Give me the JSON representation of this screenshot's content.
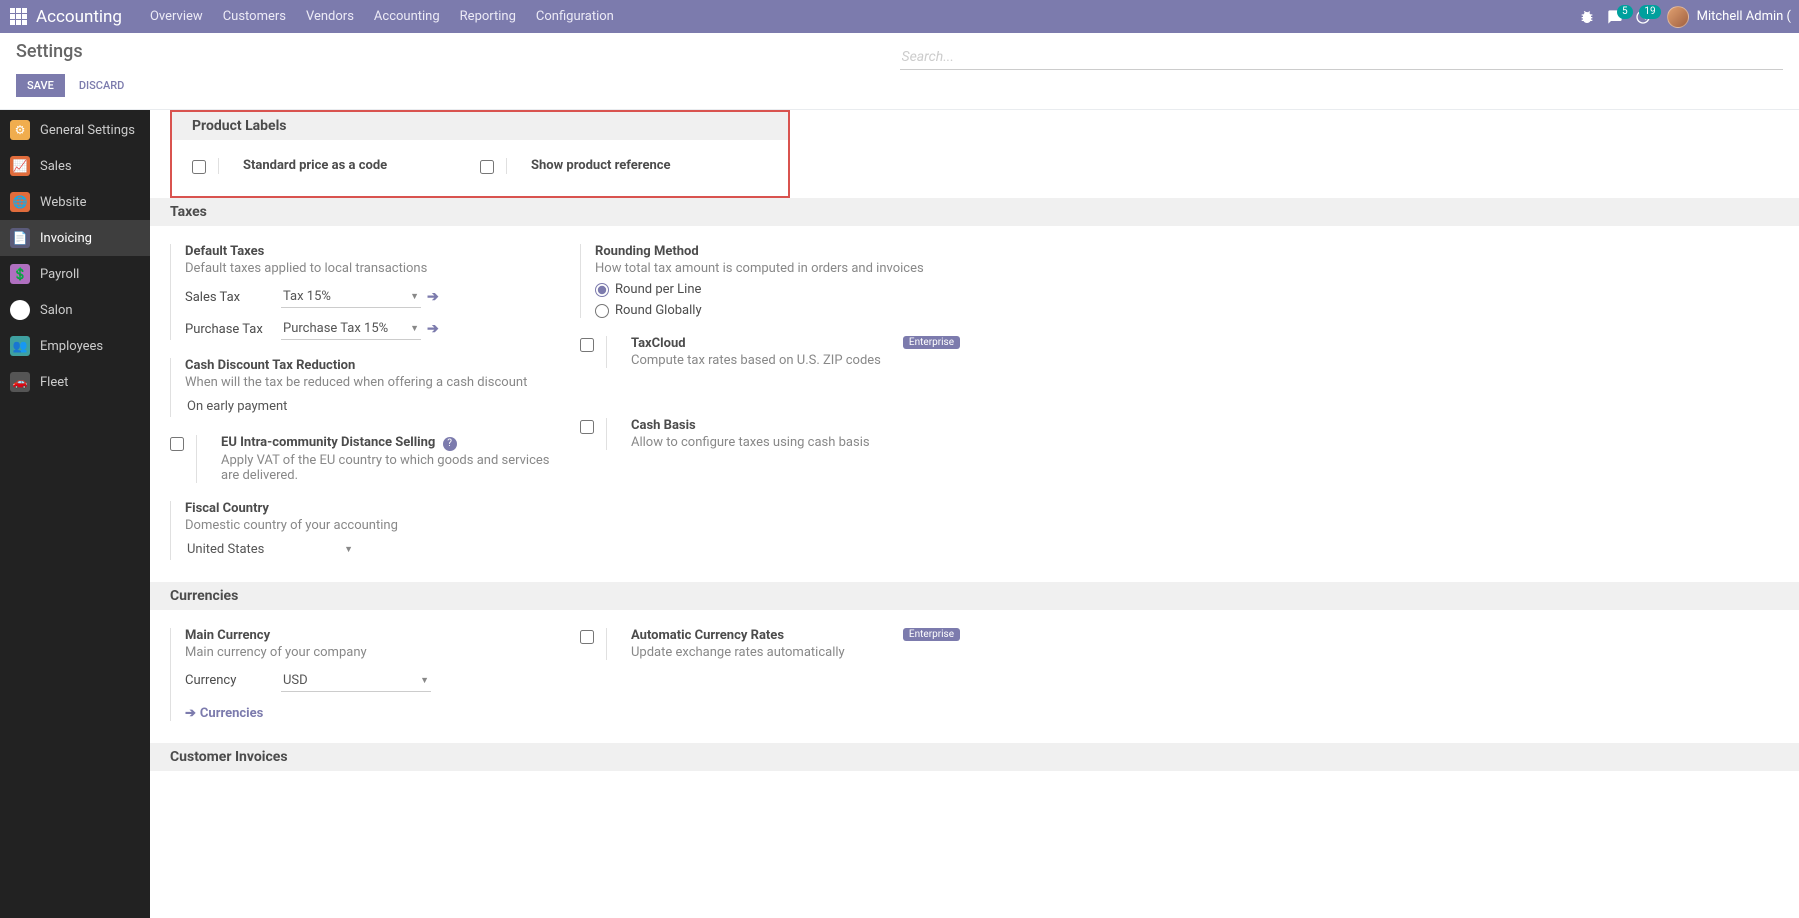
{
  "topnav": {
    "brand": "Accounting",
    "links": [
      "Overview",
      "Customers",
      "Vendors",
      "Accounting",
      "Reporting",
      "Configuration"
    ],
    "msg_badge": "5",
    "activity_badge": "19",
    "user": "Mitchell Admin ("
  },
  "control": {
    "title": "Settings",
    "save": "SAVE",
    "discard": "DISCARD",
    "search_placeholder": "Search..."
  },
  "sidebar": [
    {
      "label": "General Settings",
      "bg": "#f0ad4e"
    },
    {
      "label": "Sales",
      "bg": "#e06c3c"
    },
    {
      "label": "Website",
      "bg": "#e06c3c"
    },
    {
      "label": "Invoicing",
      "bg": "#5b5b7a",
      "active": true
    },
    {
      "label": "Payroll",
      "bg": "#b070c0"
    },
    {
      "label": "Salon",
      "bg": "#ffffff"
    },
    {
      "label": "Employees",
      "bg": "#3fa0a0"
    },
    {
      "label": "Fleet",
      "bg": "#555555"
    }
  ],
  "sections": {
    "product_labels": {
      "title": "Product Labels",
      "opt1": "Standard price as a code",
      "opt2": "Show product reference"
    },
    "taxes": {
      "title": "Taxes",
      "default": {
        "title": "Default Taxes",
        "desc": "Default taxes applied to local transactions"
      },
      "sales_tax_label": "Sales Tax",
      "sales_tax_value": "Tax 15%",
      "purchase_tax_label": "Purchase Tax",
      "purchase_tax_value": "Purchase Tax 15%",
      "rounding": {
        "title": "Rounding Method",
        "desc": "How total tax amount is computed in orders and invoices"
      },
      "round_line": "Round per Line",
      "round_global": "Round Globally",
      "cash_discount": {
        "title": "Cash Discount Tax Reduction",
        "desc": "When will the tax be reduced when offering a cash discount",
        "value": "On early payment"
      },
      "taxcloud": {
        "title": "TaxCloud",
        "desc": "Compute tax rates based on U.S. ZIP codes"
      },
      "eu": {
        "title": "EU Intra-community Distance Selling",
        "desc": "Apply VAT of the EU country to which goods and services are delivered."
      },
      "cash_basis": {
        "title": "Cash Basis",
        "desc": "Allow to configure taxes using cash basis"
      },
      "fiscal": {
        "title": "Fiscal Country",
        "desc": "Domestic country of your accounting",
        "value": "United States"
      },
      "enterprise": "Enterprise"
    },
    "currencies": {
      "title": "Currencies",
      "main": {
        "title": "Main Currency",
        "desc": "Main currency of your company"
      },
      "currency_label": "Currency",
      "currency_value": "USD",
      "currencies_link": "Currencies",
      "auto": {
        "title": "Automatic Currency Rates",
        "desc": "Update exchange rates automatically"
      },
      "enterprise": "Enterprise"
    },
    "customer_invoices": {
      "title": "Customer Invoices"
    }
  }
}
